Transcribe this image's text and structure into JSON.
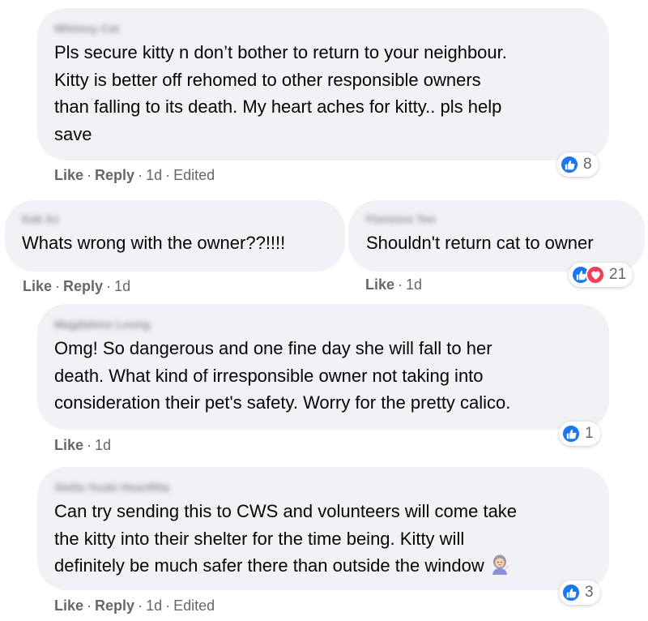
{
  "colors": {
    "bubble_bg": "#f0f2f5",
    "text": "#050505",
    "meta_text": "#65676b",
    "like_blue": "#1877f2",
    "love_red": "#f33e58"
  },
  "comments": [
    {
      "author": "Whimsy Cat",
      "text_lines": [
        "Pls secure kitty n don’t bother to return to your neighbour.",
        "Kitty is better off rehomed to other responsible owners",
        "than falling to its death. My heart aches for kitty.. pls help",
        "save"
      ],
      "actions": {
        "like": "Like",
        "reply": "Reply",
        "time": "1d",
        "edited": "Edited"
      },
      "reactions": {
        "types": [
          "like"
        ],
        "count": "8"
      }
    },
    {
      "author": "Kak Az",
      "text_lines": [
        "Whats wrong with the owner??!!!!"
      ],
      "actions": {
        "like": "Like",
        "reply": "Reply",
        "time": "1d"
      }
    },
    {
      "author": "Florence Teo",
      "text_lines": [
        "Shouldn't return cat to owner"
      ],
      "actions": {
        "like": "Like",
        "time": "1d"
      },
      "reactions": {
        "types": [
          "like",
          "love"
        ],
        "count": "21"
      }
    },
    {
      "author": "Magdalene Leong",
      "text_lines": [
        "Omg! So dangerous and one fine day she will fall to her",
        "death. What kind of irresponsible owner not taking into",
        "consideration their pet's safety. Worry for the pretty calico."
      ],
      "actions": {
        "like": "Like",
        "time": "1d"
      },
      "reactions": {
        "types": [
          "like"
        ],
        "count": "1"
      }
    },
    {
      "author": "Stella Yuuki Heartfilia",
      "text_lines": [
        "Can try sending this to CWS and volunteers will come take",
        "the kitty into their shelter for the time being. Kitty will",
        "definitely be much safer there than outside the window"
      ],
      "emoji": "woman-tipping-hand-emoji",
      "actions": {
        "like": "Like",
        "reply": "Reply",
        "time": "1d",
        "edited": "Edited"
      },
      "reactions": {
        "types": [
          "like"
        ],
        "count": "3"
      }
    }
  ],
  "separator": "·"
}
